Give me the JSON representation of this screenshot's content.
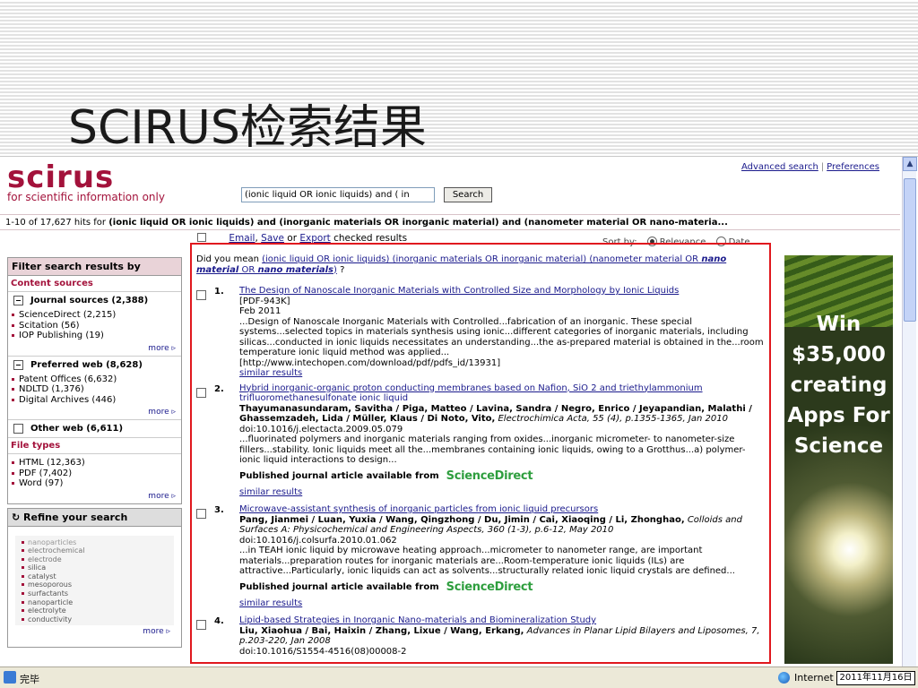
{
  "slide": {
    "title": "SCIRUS检索结果"
  },
  "header": {
    "logo": "scirus",
    "tagline": "for scientific information only",
    "links": [
      "Advanced search",
      "Preferences"
    ],
    "search_value": "(ionic liquid OR ionic liquids) and ( in",
    "search_button": "Search"
  },
  "hits": {
    "prefix": "1-10 of 17,627 hits for ",
    "query": "(ionic liquid OR ionic liquids) and (inorganic materials OR inorganic material) and (nanometer material OR nano-materia..."
  },
  "actions": {
    "email": "Email",
    "comma": ",",
    "save": "Save",
    "or": "or",
    "export": "Export",
    "suffix": "checked results"
  },
  "sort": {
    "label": "Sort by:",
    "options": [
      "Relevance",
      "Date"
    ],
    "selected": "Relevance"
  },
  "sidebar": {
    "filter_title": "Filter search results by",
    "content_sources": "Content sources",
    "groups": [
      {
        "title": "Journal sources (2,388)",
        "items": [
          "ScienceDirect (2,215)",
          "Scitation (56)",
          "IOP Publishing (19)"
        ],
        "more": "more ▹"
      },
      {
        "title": "Preferred web (8,628)",
        "items": [
          "Patent Offices (6,632)",
          "NDLTD (1,376)",
          "Digital Archives (446)"
        ],
        "more": "more ▹"
      },
      {
        "title": "Other web (6,611)",
        "items": []
      }
    ],
    "file_types_title": "File types",
    "file_types": [
      "HTML (12,363)",
      "PDF (7,402)",
      "Word (97)"
    ],
    "file_types_more": "more ▹",
    "refine_title": "Refine your search",
    "refine_terms": [
      "nanoparticles",
      "electrochemical",
      "electrode",
      "silica",
      "catalyst",
      "mesoporous",
      "surfactants",
      "nanoparticle",
      "electrolyte",
      "conductivity"
    ],
    "refine_more": "more ▹"
  },
  "did_you_mean": {
    "label": "Did you mean ",
    "l1": "(ionic liquid OR ionic liquids) (inorganic materials OR inorganic material) (nanometer material OR",
    "b1": "nano material",
    "t2": " OR ",
    "b2": "nano materials",
    "t3": ")",
    "qmark": " ?"
  },
  "results": [
    {
      "num": "1.",
      "title": "The Design of Nanoscale Inorganic Materials with Controlled Size and Morphology by Ionic Liquids",
      "lines": [
        "[PDF-943K]",
        "Feb 2011"
      ],
      "snippet": "...Design of Nanoscale Inorganic Materials with Controlled...fabrication of an inorganic. These special systems...selected topics in materials synthesis using ionic...different categories of inorganic materials, including silicas...conducted in ionic liquids necessitates an understanding...the as-prepared material is obtained in the...room temperature ionic liquid method was applied...",
      "url": "[http://www.intechopen.com/download/pdf/pdfs_id/13931]",
      "similar": "similar results"
    },
    {
      "num": "2.",
      "title": "Hybrid inorganic-organic proton conducting membranes based on Nafion, SiO 2 and triethylammonium",
      "title2": "trifluoromethanesulfonate ionic liquid",
      "authors": "Thayumanasundaram, Savitha / Piga, Matteo / Lavina, Sandra / Negro, Enrico / Jeyapandian, Malathi / Ghassemzadeh, Lida / Müller, Klaus / Di Noto, Vito,",
      "source": "Electrochimica Acta, 55 (4), p.1355-1365, Jan 2010",
      "doi": "doi:10.1016/j.electacta.2009.05.079",
      "snippet": "...fluorinated polymers and inorganic materials ranging from oxides...inorganic micrometer- to nanometer-size fillers...stability. Ionic liquids meet all the...membranes containing ionic liquids, owing to a Grotthus...a) polymer-ionic liquid interactions to design...",
      "published": "Published journal article available from",
      "provider": "ScienceDirect",
      "similar": "similar results"
    },
    {
      "num": "3.",
      "title": "Microwave-assistant synthesis of inorganic particles from ionic liquid precursors",
      "authors": "Pang, Jianmei / Luan, Yuxia / Wang, Qingzhong / Du, Jimin / Cai, Xiaoqing / Li, Zhonghao,",
      "source": "Colloids and Surfaces A: Physicochemical and Engineering Aspects, 360 (1-3), p.6-12, May 2010",
      "doi": "doi:10.1016/j.colsurfa.2010.01.062",
      "snippet": "...in TEAH ionic liquid by microwave heating approach...micrometer to nanometer range, are important materials...preparation routes for inorganic materials are...Room-temperature ionic liquids (ILs) are attractive...Particularly, ionic liquids can act as solvents...structurally related ionic liquid crystals are defined...",
      "published": "Published journal article available from",
      "provider": "ScienceDirect",
      "similar": "similar results"
    },
    {
      "num": "4.",
      "title": "Lipid-based Strategies in Inorganic Nano-materials and Biomineralization Study",
      "authors": "Liu, Xiaohua / Bai, Haixin / Zhang, Lixue / Wang, Erkang,",
      "source": "Advances in Planar Lipid Bilayers and Liposomes, 7, p.203-220, Jan 2008",
      "doi": "doi:10.1016/S1554-4516(08)00008-2"
    }
  ],
  "ad": {
    "lines": [
      "Win",
      "$35,000",
      "creating",
      "Apps For",
      "Science"
    ]
  },
  "status": {
    "done": "完毕",
    "zone": "Internet",
    "date": "2011年11月16日"
  }
}
